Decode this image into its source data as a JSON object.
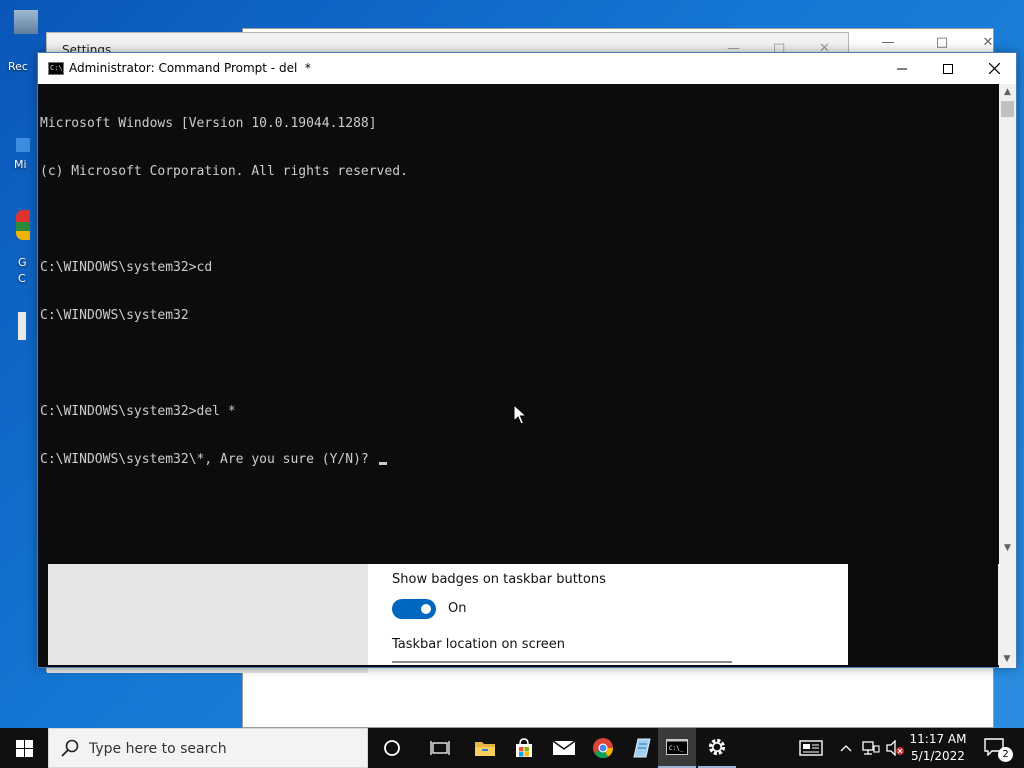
{
  "desktop": {
    "icons": [
      {
        "label": "Rec"
      },
      {
        "label": "Mi"
      },
      {
        "label": "G"
      },
      {
        "label": "C"
      }
    ]
  },
  "settings_window": {
    "title": "Settings",
    "badges_label": "Show badges on taskbar buttons",
    "badges_state": "On",
    "location_label": "Taskbar location on screen"
  },
  "cmd_window": {
    "title": "Administrator: Command Prompt - del  *",
    "app_icon_text": "C:\\_",
    "lines": [
      "Microsoft Windows [Version 10.0.19044.1288]",
      "(c) Microsoft Corporation. All rights reserved.",
      "",
      "C:\\WINDOWS\\system32>cd",
      "C:\\WINDOWS\\system32",
      "",
      "C:\\WINDOWS\\system32>del *",
      "C:\\WINDOWS\\system32\\*, Are you sure (Y/N)? "
    ]
  },
  "taskbar": {
    "search_placeholder": "Type here to search",
    "time": "11:17 AM",
    "date": "5/1/2022",
    "notification_count": "2",
    "apps": [
      {
        "name": "cortana-icon"
      },
      {
        "name": "task-view-icon"
      },
      {
        "name": "file-explorer-icon"
      },
      {
        "name": "microsoft-store-icon"
      },
      {
        "name": "mail-icon"
      },
      {
        "name": "chrome-icon"
      },
      {
        "name": "notepad-icon"
      },
      {
        "name": "command-prompt-icon"
      },
      {
        "name": "settings-icon"
      }
    ]
  },
  "colors": {
    "accent": "#0067c0",
    "console_bg": "#0c0c0c",
    "console_text": "#cccccc",
    "taskbar": "#101010"
  }
}
